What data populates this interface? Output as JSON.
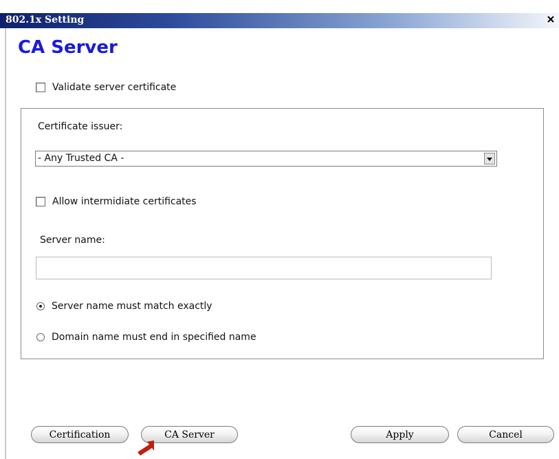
{
  "window": {
    "title": "802.1x Setting",
    "close_glyph": "✕"
  },
  "page": {
    "heading": "CA Server"
  },
  "validate": {
    "label": "Validate server certificate",
    "checked": false
  },
  "issuer": {
    "label": "Certificate issuer:",
    "selected": "- Any Trusted CA -"
  },
  "intermediate": {
    "label": "Allow intermidiate certificates",
    "checked": false
  },
  "server_name": {
    "label": "Server name:",
    "value": ""
  },
  "match": {
    "exact_label": "Server name must match exactly",
    "domain_label": "Domain name must end in specified name",
    "selected": "exact"
  },
  "buttons": {
    "certification": "Certification",
    "ca_server": "CA Server",
    "apply": "Apply",
    "cancel": "Cancel"
  },
  "colors": {
    "heading": "#1a1adc",
    "titlebar": "#10206a",
    "pointer": "#c0200c"
  }
}
